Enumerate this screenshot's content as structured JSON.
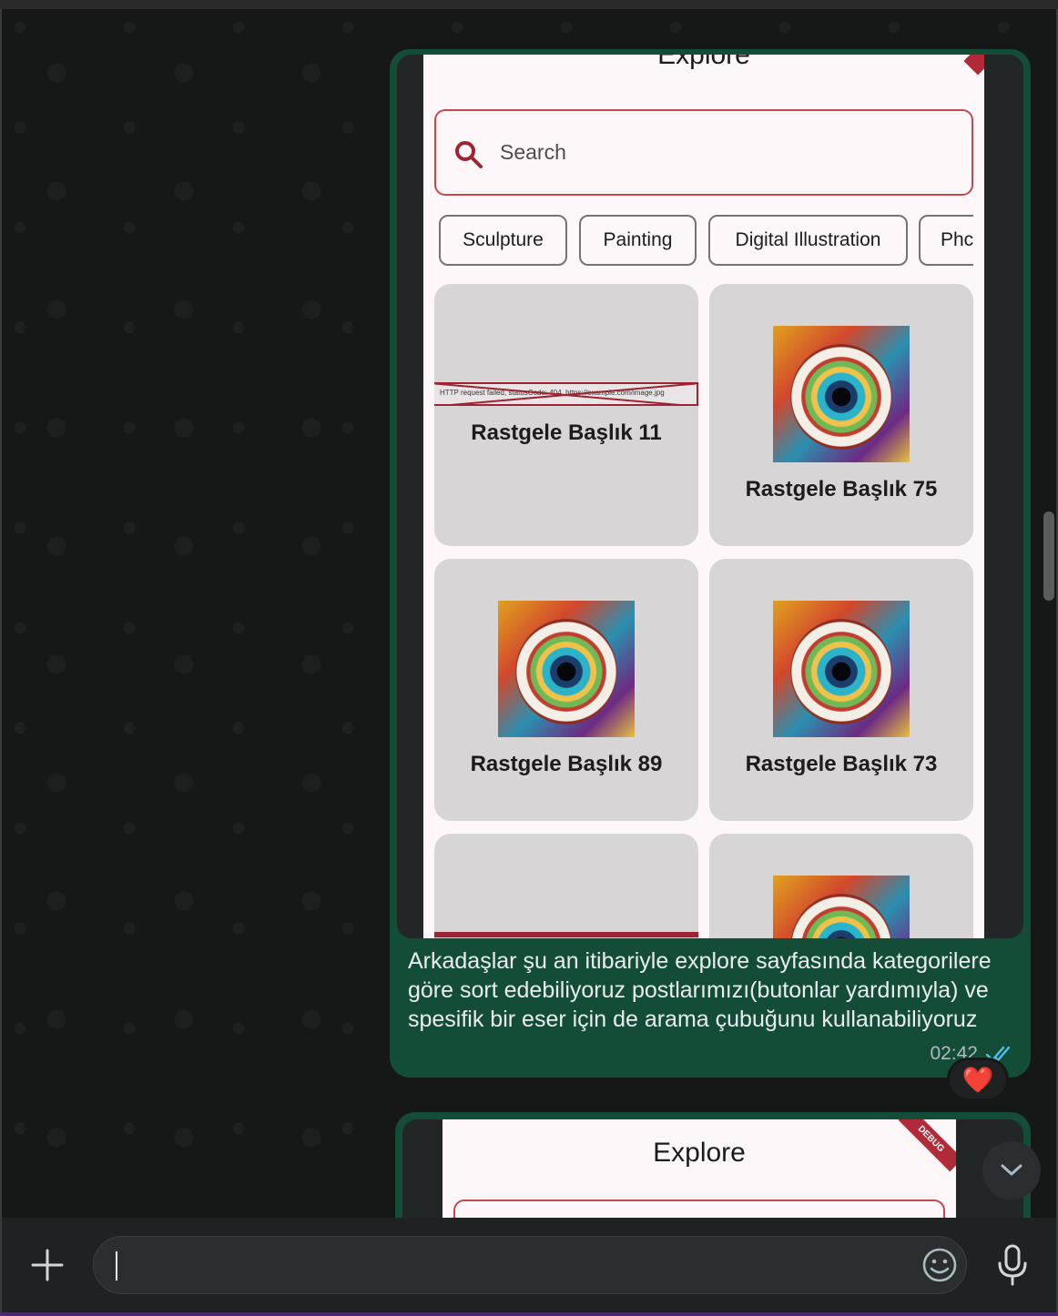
{
  "message": {
    "screenshot": {
      "title": "Explore",
      "search_placeholder": "Search",
      "categories": [
        "Sculpture",
        "Painting",
        "Digital Illustration",
        "Phc"
      ],
      "cards": [
        {
          "title": "Rastgele Başlık 11",
          "image": "broken",
          "error": "HTTP request failed, statusCode: 404, https://example.com/image.jpg"
        },
        {
          "title": "Rastgele Başlık 75",
          "image": "eye-artwork"
        },
        {
          "title": "Rastgele Başlık 89",
          "image": "eye-artwork"
        },
        {
          "title": "Rastgele Başlık 73",
          "image": "eye-artwork"
        }
      ]
    },
    "text": "Arkadaşlar şu an itibariyle explore sayfasında kategorilere göre sort edebiliyoruz postlarımızı(butonlar yardımıyla) ve spesifik bir eser için de arama çubuğunu kullanabiliyoruz",
    "time": "02:42",
    "status_icon": "double-check-icon",
    "reaction": "❤️"
  },
  "next_message": {
    "screenshot_title": "Explore",
    "debug_label": "DEBUG"
  },
  "composer": {
    "placeholder": ""
  },
  "colors": {
    "bubble": "#144d37",
    "accent_red": "#c2484f",
    "read_tick": "#53bdeb"
  }
}
